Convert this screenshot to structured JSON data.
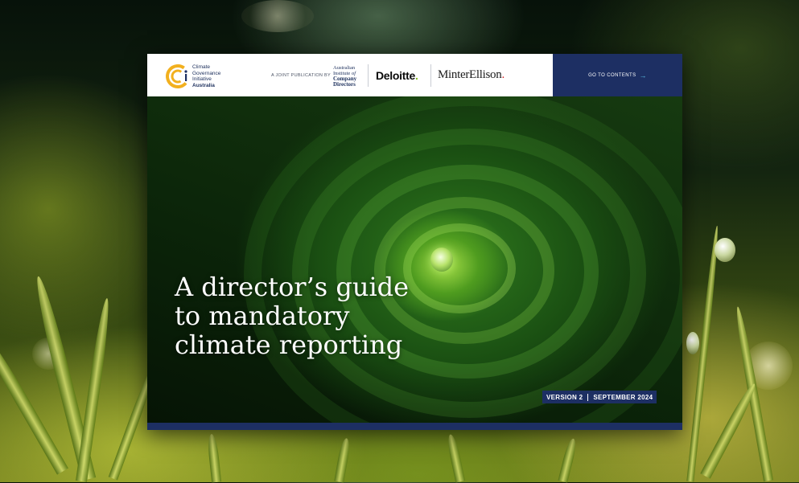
{
  "header": {
    "cgi_lines": [
      "Climate",
      "Governance",
      "Initiative"
    ],
    "cgi_country": "Australia",
    "joint_publication": "A JOINT PUBLICATION BY",
    "aicd_line1": "Australian",
    "aicd_line2_a": "Institute ",
    "aicd_line2_b": "of",
    "aicd_line3": "Company",
    "aicd_line4": "Directors",
    "deloitte": "Deloitte",
    "deloitte_dot": ".",
    "minter": "MinterEllison",
    "minter_dot": ".",
    "contents_button": "GO TO CONTENTS",
    "contents_arrow": "→"
  },
  "cover": {
    "title_lines": [
      "A director’s guide",
      "to mandatory",
      "climate reporting"
    ],
    "version": "VERSION 2",
    "date": "SEPTEMBER 2024"
  },
  "colors": {
    "navy": "#1d2f63",
    "cgi_gold": "#f2b01e",
    "deloitte_green": "#86bc25",
    "minter_red": "#d9262a",
    "link_cyan": "#5ec4e6"
  },
  "icons": {
    "cgi_logo": "cgi-logo-icon",
    "contents_arrow": "arrow-right-icon"
  }
}
